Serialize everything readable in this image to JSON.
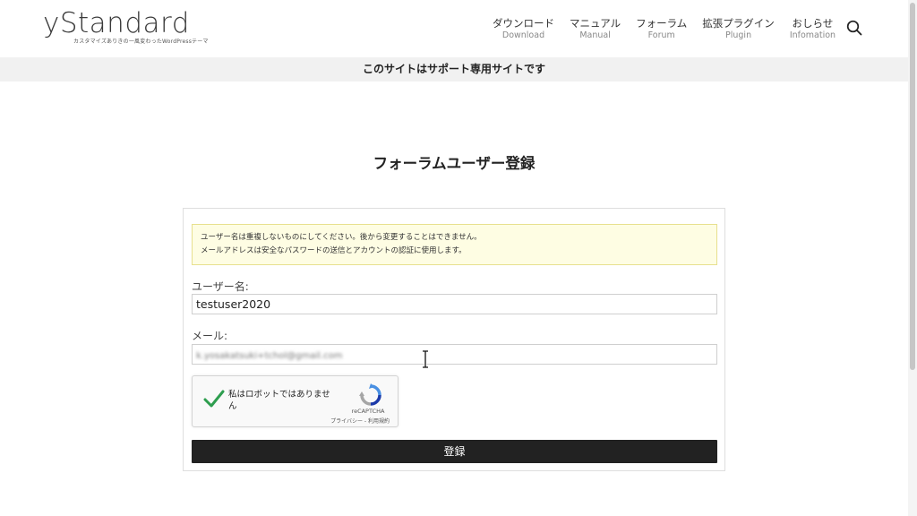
{
  "header": {
    "logo_text": "yStandard",
    "logo_tagline": "カスタマイズありきの一風変わったWordPressテーマ",
    "nav": [
      {
        "ja": "ダウンロード",
        "en": "Download"
      },
      {
        "ja": "マニュアル",
        "en": "Manual"
      },
      {
        "ja": "フォーラム",
        "en": "Forum"
      },
      {
        "ja": "拡張プラグイン",
        "en": "Plugin"
      },
      {
        "ja": "おしらせ",
        "en": "Infomation"
      }
    ]
  },
  "notice_bar": {
    "text": "このサイトはサポート専用サイトです"
  },
  "page": {
    "title": "フォーラムユーザー登録"
  },
  "form": {
    "info_lines": [
      "ユーザー名は重複しないものにしてください。後から変更することはできません。",
      "メールアドレスは安全なパスワードの送信とアカウントの認証に使用します。"
    ],
    "username_label": "ユーザー名:",
    "username_value": "testuser2020",
    "email_label": "メール:",
    "email_value": "k.yosakatsuki+tchol@gmail.com",
    "recaptcha": {
      "label": "私はロボットではありません",
      "brand": "reCAPTCHA",
      "links": "プライバシー - 利用規約"
    },
    "submit_label": "登録"
  },
  "colors": {
    "button_bg": "#222222",
    "notice_bg": "#f1f1f1",
    "info_bg": "#fefde3",
    "info_border": "#e7e08e",
    "check_green": "#2e9e4f"
  }
}
